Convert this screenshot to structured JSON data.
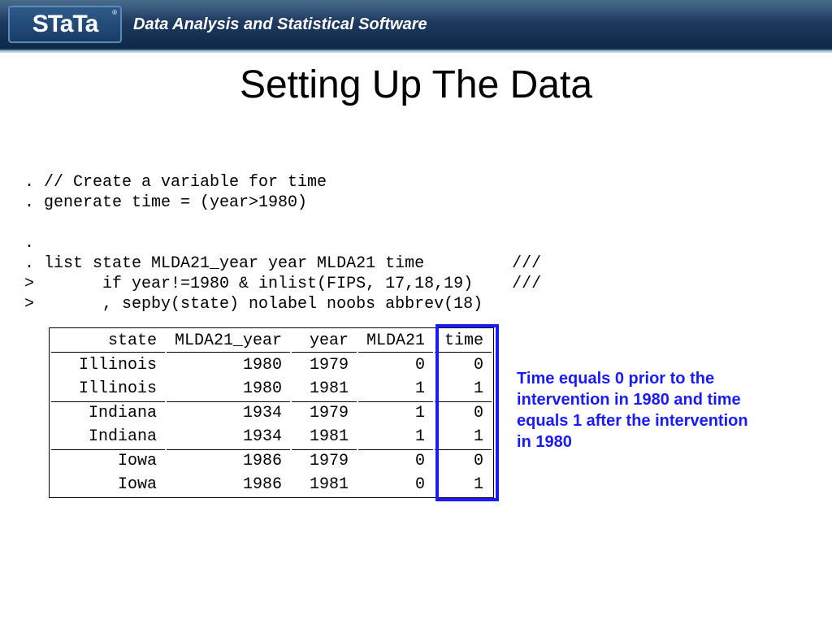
{
  "header": {
    "logo_text": "STaTa",
    "tagline": "Data Analysis and Statistical Software"
  },
  "title": "Setting Up The Data",
  "code": {
    "line1": ". // Create a variable for time",
    "line2": ". generate time = (year>1980)",
    "line3": ".",
    "line4": ". list state MLDA21_year year MLDA21 time         ///",
    "line5": ">       if year!=1980 & inlist(FIPS, 17,18,19)    ///",
    "line6": ">       , sepby(state) nolabel noobs abbrev(18)"
  },
  "table": {
    "headers": [
      "state",
      "MLDA21_year",
      "year",
      "MLDA21",
      "time"
    ],
    "groups": [
      [
        {
          "state": "Illinois",
          "mlda21_year": "1980",
          "year": "1979",
          "mlda21": "0",
          "time": "0"
        },
        {
          "state": "Illinois",
          "mlda21_year": "1980",
          "year": "1981",
          "mlda21": "1",
          "time": "1"
        }
      ],
      [
        {
          "state": "Indiana",
          "mlda21_year": "1934",
          "year": "1979",
          "mlda21": "1",
          "time": "0"
        },
        {
          "state": "Indiana",
          "mlda21_year": "1934",
          "year": "1981",
          "mlda21": "1",
          "time": "1"
        }
      ],
      [
        {
          "state": "Iowa",
          "mlda21_year": "1986",
          "year": "1979",
          "mlda21": "0",
          "time": "0"
        },
        {
          "state": "Iowa",
          "mlda21_year": "1986",
          "year": "1981",
          "mlda21": "0",
          "time": "1"
        }
      ]
    ]
  },
  "annotation": "Time equals 0 prior to the intervention in 1980 and time equals 1 after the intervention in 1980"
}
